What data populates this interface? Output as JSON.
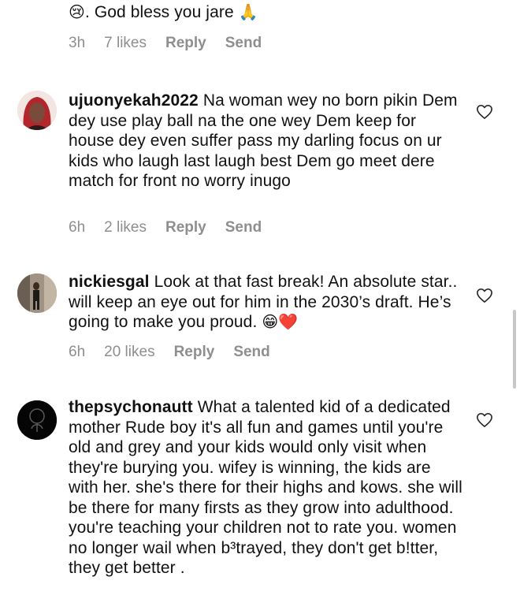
{
  "comments": [
    {
      "text_line1": ". God bless you jare",
      "emoji_before": "😢",
      "emoji_after": "🙏",
      "time": "3h",
      "likes": "7 likes",
      "reply": "Reply",
      "send": "Send"
    },
    {
      "username": "ujuonyekah2022",
      "text": "Na woman wey no born pikin Dem dey use play ball  na the one wey Dem keep for house dey even suffer pass my darling focus on ur kids who laugh last laugh best Dem go meet dere match for front no worry inugo",
      "time": "6h",
      "likes": "2 likes",
      "reply": "Reply",
      "send": "Send"
    },
    {
      "username": "nickiesgal",
      "text": "Look at that fast break! An absolute star.. will keep an eye out for him in the 2030’s draft. He’s going to make you proud.",
      "emoji_end": "😁❤️",
      "time": "6h",
      "likes": "20 likes",
      "reply": "Reply",
      "send": "Send"
    },
    {
      "username": "thepsychonautt",
      "text": "What a talented kid of a dedicated mother  Rude boy it's all fun and games until you're old and grey and your kids would only visit when they're burying you. wifey is winning, the kids are with her. she's there for their highs and kows. she will be there for many firsts as they grow into adulthood. you're teaching your children not to rate you. women no longer wail when b³trayed, they don't get b!tter, they get better ."
    }
  ],
  "icons": {
    "heart": "heart-outline-icon"
  },
  "colors": {
    "meta_gray": "#8e8e8e",
    "text": "#111111",
    "heart_red": "#e0242b"
  }
}
